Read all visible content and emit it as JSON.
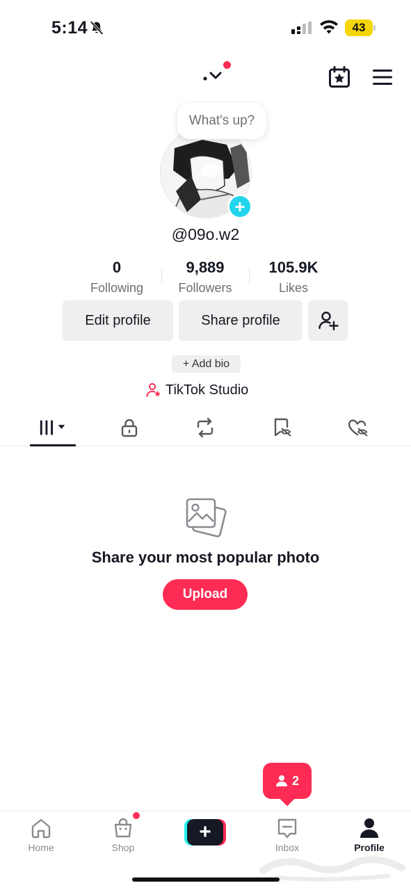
{
  "status_bar": {
    "time": "5:14",
    "battery": "43"
  },
  "top_bar": {
    "switch_account": "",
    "calendar_icon": "calendar-star-icon",
    "menu_icon": "hamburger-menu-icon"
  },
  "profile": {
    "note_bubble": "What's up?",
    "username": "@09o.w2",
    "stats": [
      {
        "value": "0",
        "label": "Following"
      },
      {
        "value": "9,889",
        "label": "Followers"
      },
      {
        "value": "105.9K",
        "label": "Likes"
      }
    ],
    "edit_profile": "Edit profile",
    "share_profile": "Share profile",
    "add_bio": "+ Add bio",
    "studio": "TikTok Studio"
  },
  "tabs": [
    {
      "icon": "grid-videos-icon",
      "active": true
    },
    {
      "icon": "lock-icon",
      "active": false
    },
    {
      "icon": "repost-icon",
      "active": false
    },
    {
      "icon": "bookmark-hidden-icon",
      "active": false
    },
    {
      "icon": "heart-hidden-icon",
      "active": false
    }
  ],
  "empty_state": {
    "title": "Share your most popular photo",
    "upload": "Upload"
  },
  "follow_requests": {
    "count": "2"
  },
  "bottom_nav": {
    "home": "Home",
    "shop": "Shop",
    "inbox": "Inbox",
    "profile": "Profile"
  },
  "colors": {
    "accent": "#fe2c55",
    "cyan": "#20d5ec",
    "text": "#161823",
    "muted": "#6e6e73"
  }
}
